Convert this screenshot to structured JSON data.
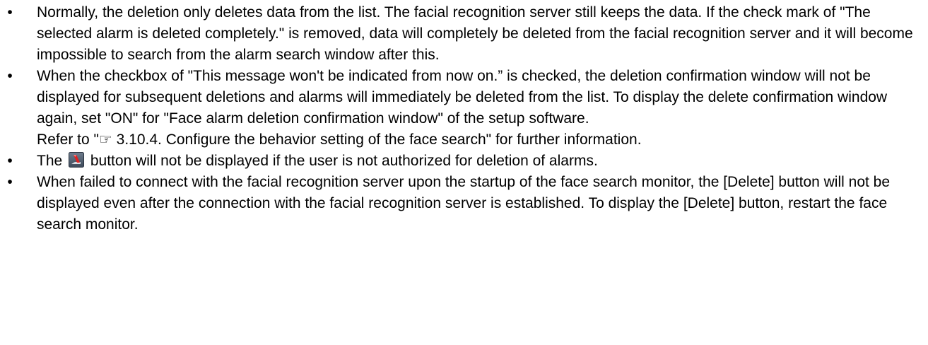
{
  "notes": {
    "bullet_glyph": "•",
    "item1": {
      "text": "Normally, the deletion only deletes data from the list. The facial recognition server still keeps the data. If the check mark of \"The selected alarm is deleted completely.\" is removed, data will completely be deleted from the facial recognition server and it will become impossible to search from the alarm search window after this."
    },
    "item2": {
      "text": "When the checkbox of \"This message won't be indicated from now on.” is checked, the deletion confirmation window will not be displayed for subsequent deletions and alarms will immediately be deleted from the list. To display the delete confirmation window again, set \"ON\" for \"Face alarm deletion confirmation window\" of the setup software.",
      "refer": "Refer to \"☞ 3.10.4. Configure the behavior setting of the face search\" for further information."
    },
    "item3": {
      "text_before": "The",
      "icon": "delete-alarm-icon",
      "text_after": "button will not be displayed if the user is not authorized for deletion of alarms."
    },
    "item4": {
      "text": "When failed to connect with the facial recognition server upon the startup of the face search monitor, the [Delete] button will not be displayed even after the connection with the facial recognition server is established. To display the [Delete] button, restart the face search monitor."
    }
  }
}
